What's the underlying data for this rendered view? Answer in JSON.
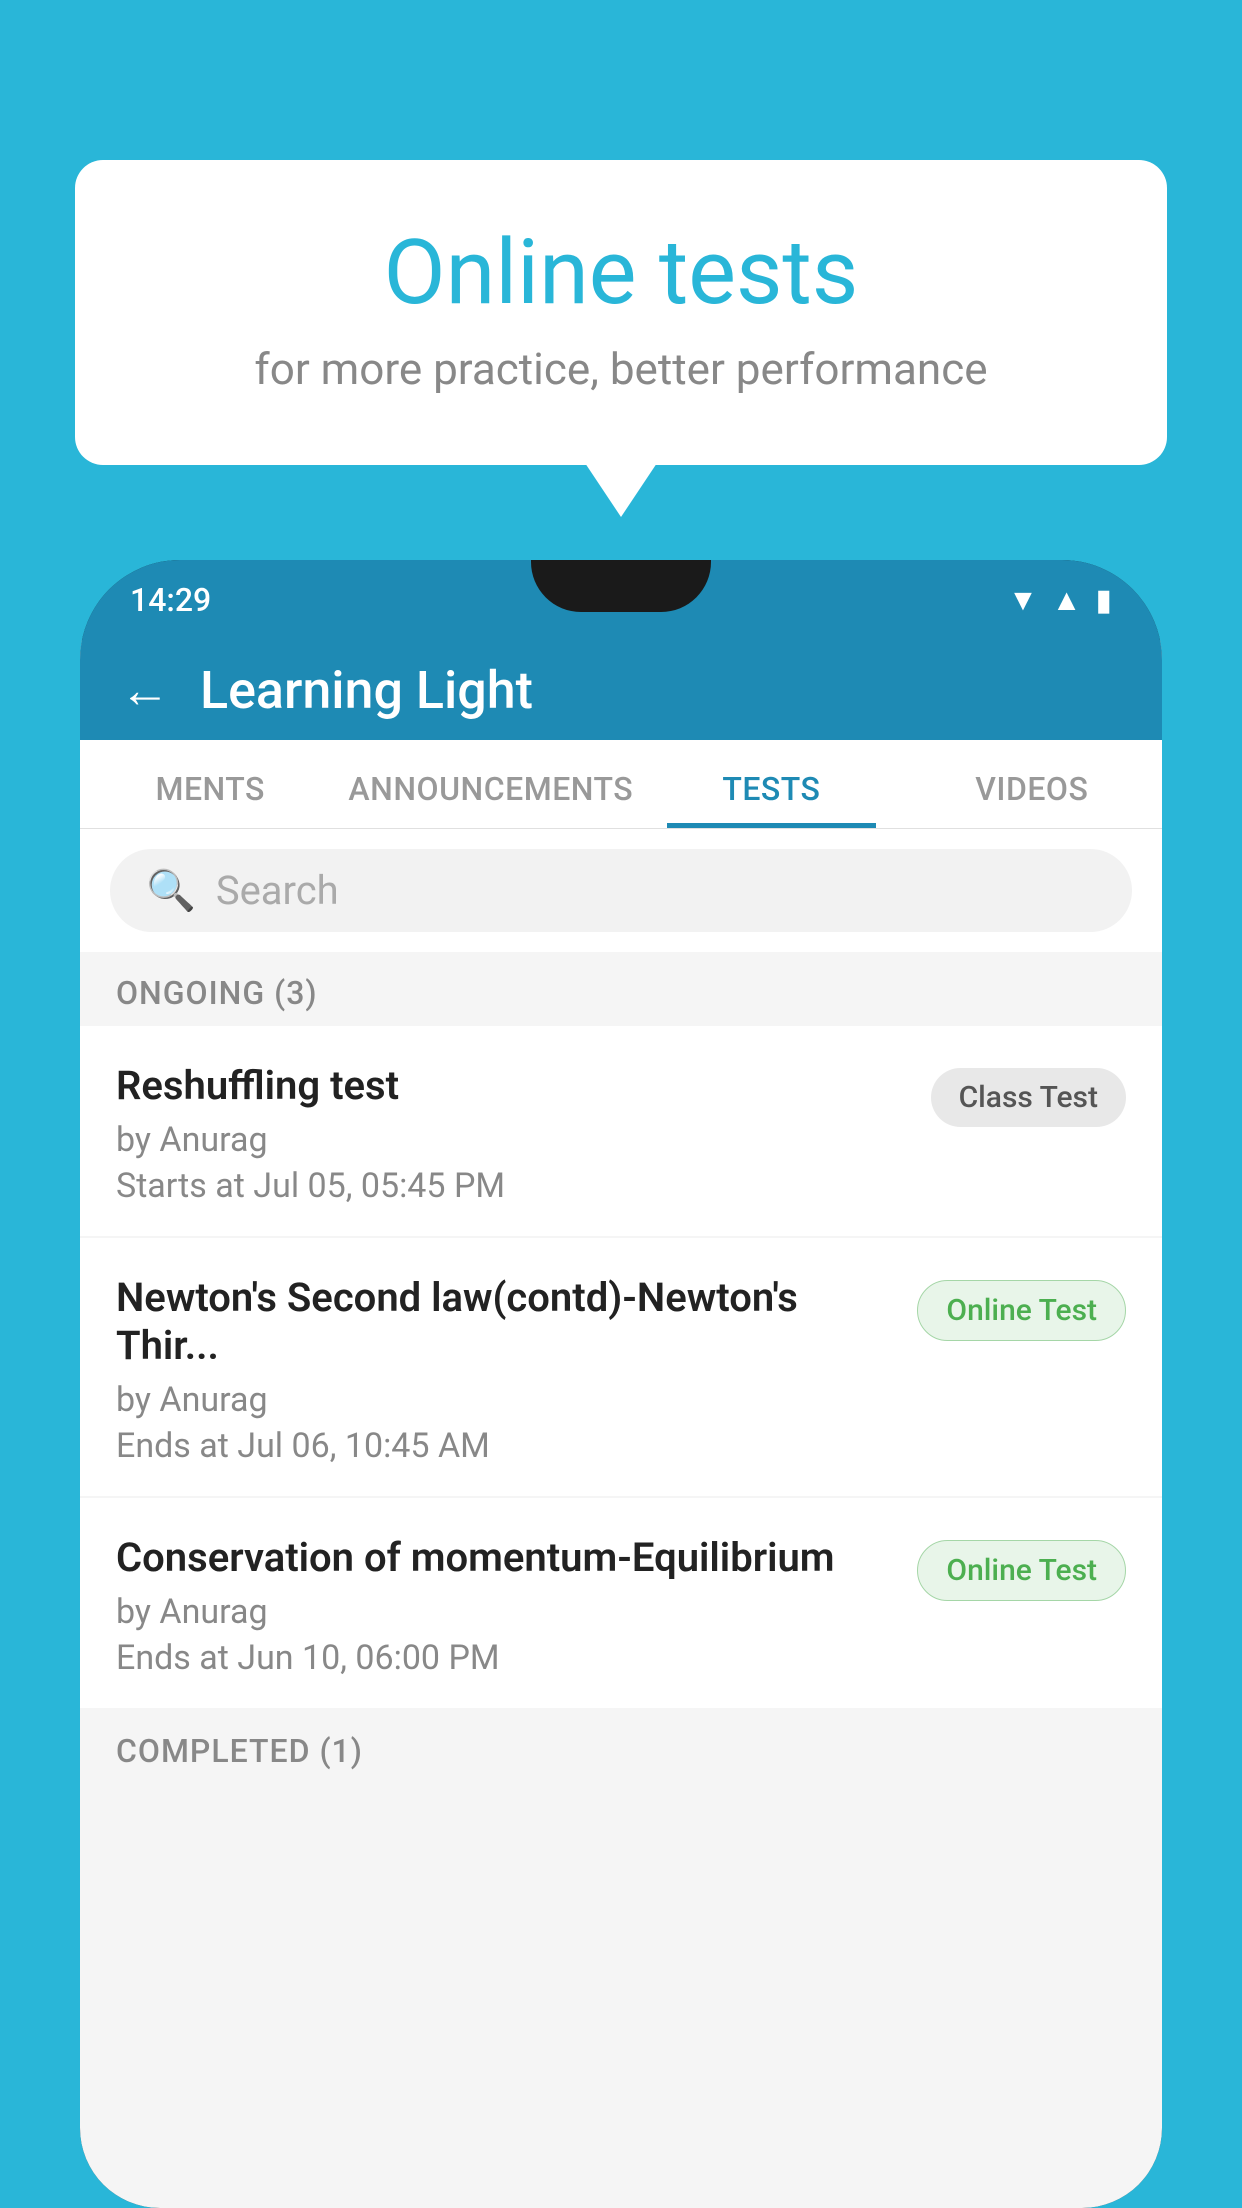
{
  "background": {
    "color": "#29b6d8"
  },
  "bubble": {
    "title": "Online tests",
    "subtitle": "for more practice, better performance"
  },
  "phone": {
    "status_time": "14:29",
    "app_title": "Learning Light",
    "back_label": "←",
    "tabs": [
      {
        "id": "ments",
        "label": "MENTS",
        "active": false
      },
      {
        "id": "announcements",
        "label": "ANNOUNCEMENTS",
        "active": false
      },
      {
        "id": "tests",
        "label": "TESTS",
        "active": true
      },
      {
        "id": "videos",
        "label": "VIDEOS",
        "active": false
      }
    ],
    "search_placeholder": "Search",
    "ongoing_section": "ONGOING (3)",
    "tests": [
      {
        "name": "Reshuffling test",
        "by": "by Anurag",
        "time": "Starts at  Jul 05, 05:45 PM",
        "badge": "Class Test",
        "badge_type": "class"
      },
      {
        "name": "Newton's Second law(contd)-Newton's Thir...",
        "by": "by Anurag",
        "time": "Ends at  Jul 06, 10:45 AM",
        "badge": "Online Test",
        "badge_type": "online"
      },
      {
        "name": "Conservation of momentum-Equilibrium",
        "by": "by Anurag",
        "time": "Ends at  Jun 10, 06:00 PM",
        "badge": "Online Test",
        "badge_type": "online"
      }
    ],
    "completed_section": "COMPLETED (1)"
  }
}
